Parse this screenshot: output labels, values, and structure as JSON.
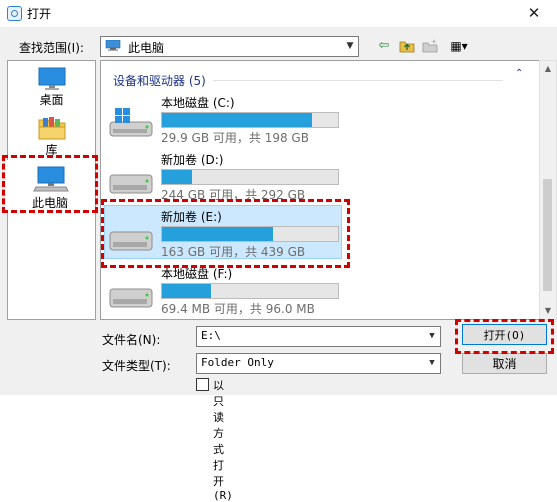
{
  "window": {
    "title": "打开",
    "close_glyph": "✕"
  },
  "toolbar": {
    "look_in_label": "查找范围(I):",
    "look_in_value": "此电脑",
    "combo_arrow": "▼",
    "back_glyph": "⇦",
    "view_glyph": "▦▾"
  },
  "places": [
    {
      "label": "桌面",
      "icon": "desktop-icon"
    },
    {
      "label": "库",
      "icon": "library-folder-icon"
    },
    {
      "label": "此电脑",
      "icon": "this-pc-icon"
    }
  ],
  "group": {
    "header": "设备和驱动器 (5)",
    "toggle_glyph": "⌃"
  },
  "drives": [
    {
      "name": "本地磁盘 (C:)",
      "info": "29.9 GB 可用，共 198 GB",
      "used_fraction": 0.85,
      "icon": "windows-drive-icon"
    },
    {
      "name": "新加卷 (D:)",
      "info": "244 GB 可用，共 292 GB",
      "used_fraction": 0.17,
      "icon": "hard-drive-icon"
    },
    {
      "name": "新加卷 (E:)",
      "info": "163 GB 可用，共 439 GB",
      "used_fraction": 0.63,
      "icon": "hard-drive-icon",
      "selected": true
    },
    {
      "name": "本地磁盘 (F:)",
      "info": "69.4 MB 可用，共 96.0 MB",
      "used_fraction": 0.28,
      "icon": "hard-drive-icon"
    }
  ],
  "footer": {
    "filename_label": "文件名(N):",
    "filename_value": "E:\\",
    "filetype_label": "文件类型(T):",
    "filetype_value": "Folder Only",
    "readonly_label": "以只读方式打开(R)",
    "open_button": "打开(O)",
    "cancel_button": "取消"
  },
  "colors": {
    "highlight": "#d40000",
    "progress": "#26a0da",
    "selection": "#cce8ff",
    "group_header": "#1e3287"
  }
}
